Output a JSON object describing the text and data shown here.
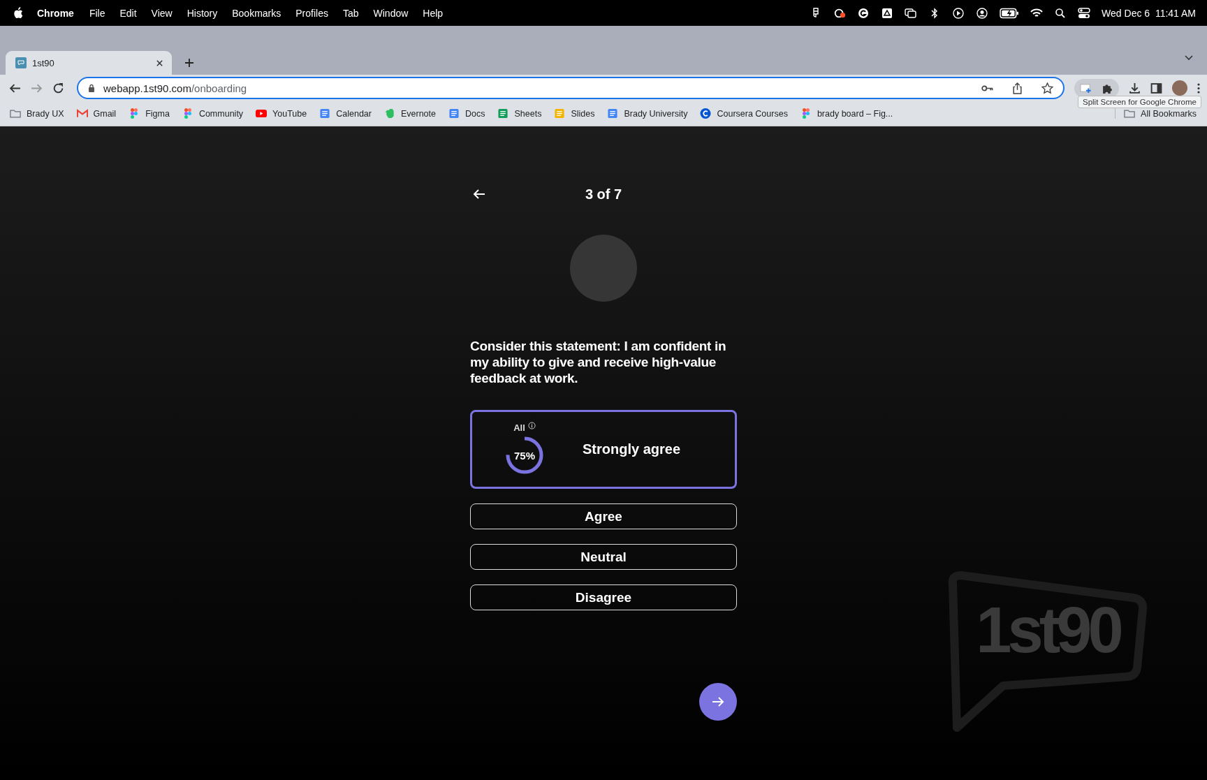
{
  "menu_bar": {
    "app": "Chrome",
    "items": [
      "File",
      "Edit",
      "View",
      "History",
      "Bookmarks",
      "Profiles",
      "Tab",
      "Window",
      "Help"
    ],
    "clock": "Wed Dec 6  11:41 AM"
  },
  "browser": {
    "tabs": [
      {
        "title": "1st90",
        "selected": true
      }
    ],
    "address": {
      "host": "webapp.1st90.com",
      "path": "/onboarding"
    },
    "tooltip": "Split Screen for Google Chrome",
    "bookmarks": [
      {
        "label": "Brady UX",
        "kind": "folder"
      },
      {
        "label": "Gmail",
        "kind": "gmail"
      },
      {
        "label": "Figma",
        "kind": "figma"
      },
      {
        "label": "Community",
        "kind": "figma"
      },
      {
        "label": "YouTube",
        "kind": "youtube"
      },
      {
        "label": "Calendar",
        "kind": "calendar"
      },
      {
        "label": "Evernote",
        "kind": "evernote"
      },
      {
        "label": "Docs",
        "kind": "docs"
      },
      {
        "label": "Sheets",
        "kind": "sheets"
      },
      {
        "label": "Slides",
        "kind": "slides"
      },
      {
        "label": "Brady University",
        "kind": "docs"
      },
      {
        "label": "Coursera Courses",
        "kind": "coursera"
      },
      {
        "label": "brady board – Fig...",
        "kind": "figma"
      }
    ],
    "all_bookmarks": "All Bookmarks"
  },
  "page": {
    "step": "3 of 7",
    "question": "Consider this statement: I am confident in my ability to give and receive high-value feedback at work.",
    "options": [
      {
        "label": "Strongly agree",
        "selected": true,
        "stats": {
          "filter": "All",
          "percent": "75%",
          "level": 0.75
        }
      },
      {
        "label": "Agree",
        "selected": false
      },
      {
        "label": "Neutral",
        "selected": false
      },
      {
        "label": "Disagree",
        "selected": false
      }
    ],
    "logo": "1st90"
  }
}
